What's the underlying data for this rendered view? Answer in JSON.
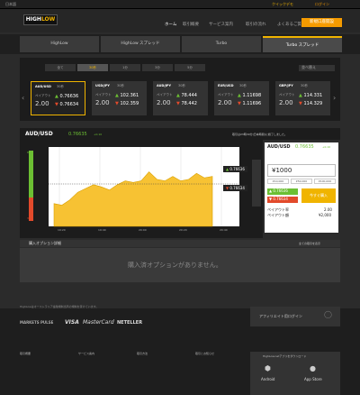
{
  "topbar": {
    "lang": "日本語",
    "demo": "クイックデモ",
    "login": "ログイン"
  },
  "nav": {
    "home": "ホーム",
    "guide": "取引概要",
    "service": "サービス案内",
    "market": "取引の流れ",
    "faq": "よくあるご質問",
    "announce": "各種お知らせ",
    "register": "新規口座開設"
  },
  "tabs": [
    "HighLow",
    "HighLow スプレッド",
    "Turbo",
    "Turbo スプレッド"
  ],
  "subtabs": [
    "全て",
    "30秒",
    "1分",
    "3分",
    "5分"
  ],
  "sort": "並べ替え",
  "cards": [
    {
      "name": "AUD/USD",
      "time": "30秒",
      "pay_label": "ペイアウト",
      "pay": "2.00",
      "hi": "0.76636",
      "lo": "0.76634"
    },
    {
      "name": "USD/JPY",
      "time": "30秒",
      "pay_label": "ペイアウト",
      "pay": "2.00",
      "hi": "102.361",
      "lo": "102.359"
    },
    {
      "name": "AUD/JPY",
      "time": "30秒",
      "pay_label": "ペイアウト",
      "pay": "2.00",
      "hi": "78.444",
      "lo": "78.442"
    },
    {
      "name": "EUR/USD",
      "time": "30秒",
      "pay_label": "ペイアウト",
      "pay": "2.00",
      "hi": "1.11698",
      "lo": "1.11696"
    },
    {
      "name": "GBP/JPY",
      "time": "30秒",
      "pay_label": "ペイアウト",
      "pay": "2.00",
      "hi": "114.331",
      "lo": "114.329"
    }
  ],
  "chart": {
    "pair": "AUD/USD",
    "rate": "0.76635",
    "change": "+0.10",
    "notice": "取引は23時30分(日本時間)に終了しました。",
    "high": "0.76636",
    "low": "0.76634",
    "times": [
      "19:20",
      "19:40",
      "20:00",
      "20:20",
      "20:40"
    ],
    "pct_high": "67%",
    "pct_low": "33%"
  },
  "chart_data": {
    "type": "area",
    "x": [
      0,
      1,
      2,
      3,
      4,
      5,
      6,
      7,
      8,
      9,
      10,
      11,
      12,
      13,
      14,
      15,
      16,
      17,
      18,
      19,
      20
    ],
    "values": [
      0.3,
      0.28,
      0.35,
      0.45,
      0.5,
      0.55,
      0.52,
      0.48,
      0.55,
      0.6,
      0.58,
      0.6,
      0.72,
      0.62,
      0.6,
      0.66,
      0.6,
      0.62,
      0.7,
      0.64,
      0.66
    ]
  },
  "trade": {
    "pair": "AUD/USD",
    "rate": "0.76635",
    "change": "+0.10",
    "amount_label": "¥1000",
    "amounts": [
      "¥10,000",
      "¥50,000",
      "¥100,000"
    ],
    "high": "0.76636",
    "low": "0.76634",
    "buy": "今すぐ購入",
    "pay_rate_label": "ペイアウト率",
    "pay_rate": "2.00",
    "payout_label": "ペイアウト額",
    "payout": "¥2,000"
  },
  "positions": {
    "title": "購入オプション詳細",
    "all": "全ての取引を表示",
    "empty": "購入済オプションがありません。"
  },
  "footer": {
    "company": "HighLowはオーストラリア金融規制当局の規制を受けています。",
    "affiliate": "アフィリエイト用ログイン",
    "app": "HighLow.netアプリをダウンロード",
    "android": "Android",
    "appstore": "App Store",
    "brands": [
      "MARKETS PULSE",
      "VISA",
      "MasterCard",
      "NETELLER"
    ],
    "cols": [
      "取引概要",
      "サービス案内",
      "取引方法",
      "取引とお知らせ"
    ]
  }
}
